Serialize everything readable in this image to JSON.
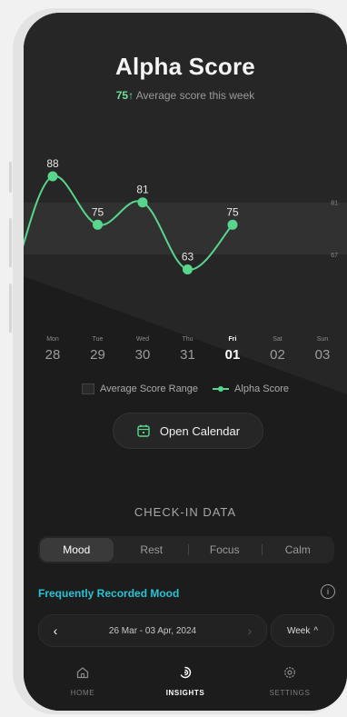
{
  "header": {
    "title": "Alpha Score",
    "avg_score": "75",
    "avg_arrow": "↑",
    "avg_label": "Average score this week"
  },
  "chart_data": {
    "type": "line",
    "categories": [
      "Mon 28",
      "Tue 29",
      "Wed 30",
      "Thu 31",
      "Fri 01",
      "Sat 02",
      "Sun 03"
    ],
    "series": [
      {
        "name": "Alpha Score",
        "values": [
          88,
          75,
          81,
          63,
          75,
          null,
          null
        ]
      }
    ],
    "range_band": {
      "low": 67,
      "high": 81
    },
    "right_ticks": [
      "81",
      "67"
    ],
    "legend": [
      "Average Score Range",
      "Alpha Score"
    ],
    "colors": {
      "line": "#58d68d"
    }
  },
  "days": [
    {
      "name": "Mon",
      "date": "28",
      "active": false
    },
    {
      "name": "Tue",
      "date": "29",
      "active": false
    },
    {
      "name": "Wed",
      "date": "30",
      "active": false
    },
    {
      "name": "Thu",
      "date": "31",
      "active": false
    },
    {
      "name": "Fri",
      "date": "01",
      "active": true
    },
    {
      "name": "Sat",
      "date": "02",
      "active": false
    },
    {
      "name": "Sun",
      "date": "03",
      "active": false
    }
  ],
  "legend": {
    "range_label": "Average Score Range",
    "score_label": "Alpha Score"
  },
  "open_calendar": {
    "label": "Open Calendar"
  },
  "checkin": {
    "title": "CHECK-IN DATA",
    "tabs": [
      "Mood",
      "Rest",
      "Focus",
      "Calm"
    ],
    "active_tab": "Mood",
    "frequent_label": "Frequently Recorded Mood",
    "info_icon": "i"
  },
  "date_range": {
    "text": "26 Mar - 03 Apr, 2024",
    "prev": "‹",
    "next": "›"
  },
  "period_select": {
    "label": "Week",
    "chevron": "^"
  },
  "nav": {
    "items": [
      {
        "label": "HOME",
        "icon": "home-icon",
        "active": false
      },
      {
        "label": "INSIGHTS",
        "icon": "insights-icon",
        "active": true
      },
      {
        "label": "SETTINGS",
        "icon": "settings-icon",
        "active": false
      }
    ]
  },
  "colors": {
    "accent_green": "#58d68d",
    "score_green": "#6fe39a",
    "link_cyan": "#28c3d4",
    "background": "#1c1c1c"
  }
}
